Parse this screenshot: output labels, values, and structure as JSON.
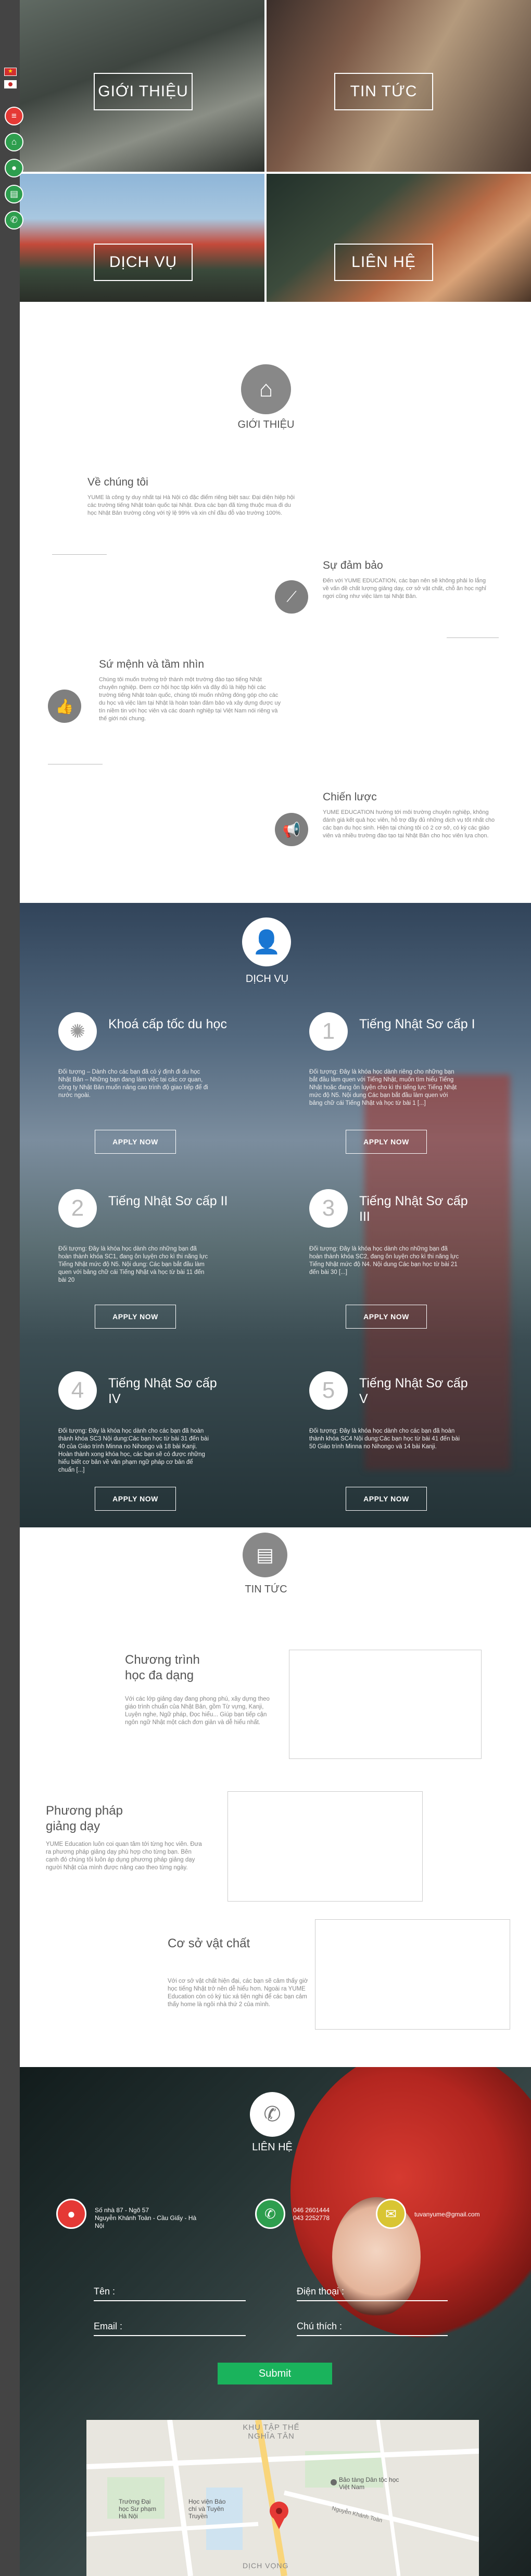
{
  "nav": {
    "tiles": [
      "GIỚI THIỆU",
      "TIN TỨC",
      "DỊCH VỤ",
      "LIÊN HỆ"
    ]
  },
  "about": {
    "title": "GIỚI THIỆU",
    "blocks": [
      {
        "heading": "Về chúng tôi",
        "text": "YUME là công ty duy nhất tại Hà Nội có đặc điểm riêng biệt sau: Đại diện hiệp hội các trường tiếng Nhật toàn quốc tại Nhật. Đưa các bạn đã từng thuộc mua đi du học Nhật Bản trường công với tỷ lệ 99% và xin chỉ đầu đỗ vào trường 100%."
      },
      {
        "heading": "Sự đảm bảo",
        "text": "Đến với YUME EDUCATION, các bạn nên sẽ không phải lo lắng về vấn đề chất lượng giảng dạy, cơ sở vật chất, chỗ ăn học nghỉ ngơi cũng như việc làm tại Nhật Bản."
      },
      {
        "heading": "Sứ mệnh và tầm nhìn",
        "text": "Chúng tôi muốn trường trở thành một trường đào tạo tiếng Nhật chuyên nghiệp. Đem cơ hội học tập kiến và đây đủ là hiệp hội các trường tiếng Nhật toàn quốc, chúng tôi muốn những đóng góp cho các du học và việc làm tại Nhật là hoàn toàn đảm bảo và xây dựng được uy tín niềm tin với học viên và các doanh nghiệp tại Việt Nam nói riêng và thế giới nói chung."
      },
      {
        "heading": "Chiến lược",
        "text": "YUME EDUCATION hướng tới môi trường chuyên nghiệp, không đánh giá kết quả học viên, hỗ trợ đầy đủ những dịch vụ tốt nhất cho các bạn du học sinh. Hiện tại chúng tôi có 2 cơ sở, có kỳ các giáo viên và nhiều trường đào tạo tại Nhật Bản cho học viên lựa chọn."
      }
    ]
  },
  "services": {
    "title": "DỊCH VỤ",
    "apply_label": "APPLY NOW",
    "items": [
      {
        "num": "",
        "name": "Khoá cấp tốc du học",
        "desc": "Đối tượng – Dành cho các bạn đã có ý định đi du học Nhật Bản – Những bạn đang làm việc tại các cơ quan, công ty Nhật Bản muốn nâng cao trình độ giao tiếp để đi nước ngoài."
      },
      {
        "num": "1",
        "name": "Tiếng Nhật Sơ cấp I",
        "desc": "Đối tượng: Đây là khóa học dành riêng cho những bạn bắt đầu làm quen với Tiếng Nhật, muốn tìm hiểu Tiếng Nhật hoặc đang ôn luyện cho kì thi tiếng lực Tiếng Nhật mức độ N5. Nội dung Các bạn bắt đầu làm quen với bảng chữ cái Tiếng Nhật và học từ bài 1 [...]"
      },
      {
        "num": "2",
        "name": "Tiếng Nhật Sơ cấp II",
        "desc": "Đối tượng: Đây là khóa học dành cho những bạn đã hoàn thành khóa SC1, đang ôn luyện cho kì thi năng lực Tiếng Nhật mức độ N5. Nội dung: Các bạn bắt đầu làm quen với bảng chữ cái Tiếng Nhật và học từ bài 11 đến bài 20"
      },
      {
        "num": "3",
        "name": "Tiếng Nhật Sơ cấp III",
        "desc": "Đối tượng: Đây là khóa học dành cho những bạn đã hoàn thành khóa SC2, đang ôn luyện cho kì thi năng lực Tiếng Nhật mức độ N4. Nội dung Các bạn học từ bài 21 đến bài 30 [...]"
      },
      {
        "num": "4",
        "name": "Tiếng Nhật Sơ cấp IV",
        "desc": "Đối tượng: Đây là khóa học dành cho các bạn đã hoàn thành khóa SC3 Nội dung:Các bạn học từ bài 31 đến bài 40 của Giáo trình Minna no Nihongo và 18 bài Kanji. Hoàn thành xong khóa học, các bạn sẽ có được những hiểu biết cơ bản về văn phạm ngữ pháp cơ bản để chuẩn [...]"
      },
      {
        "num": "5",
        "name": "Tiếng Nhật Sơ cấp V",
        "desc": "Đối tượng: Đây là khóa học dành cho các bạn đã hoàn thành khóa SC4 Nội dung:Các bạn học từ bài 41 đến bài 50 Giáo trình Minna no Nihongo và 14 bài Kanji."
      }
    ]
  },
  "news": {
    "title": "TIN TỨC",
    "items": [
      {
        "heading": "Chương trình học đa dạng",
        "text": "Với các lớp giảng dạy đang phong phú, xây dựng theo giáo trình chuẩn của Nhật Bản, gồm Từ vựng, Kanji, Luyện nghe, Ngữ pháp, Đọc hiểu... Giúp bạn tiếp cận ngôn ngữ Nhật một cách đơn giản và dễ hiểu nhất."
      },
      {
        "heading": "Phương pháp giảng dạy",
        "text": "YUME Education luôn coi quan tâm tới từng học viên. Đưa ra phương pháp giảng dạy phù hợp cho từng bạn. Bên cạnh đó chúng tôi luôn áp dụng phương pháp giảng dạy người Nhật của mình được nâng cao theo từng ngày."
      },
      {
        "heading": "Cơ sở vật chất",
        "text": "Với cơ sở vật chất hiện đại, các bạn sẽ cảm thấy giờ học tiếng Nhật trở nên dễ hiểu hơn. Ngoài ra YUME Education còn có ký túc xá tiện nghi để các bạn cảm thấy home là ngôi nhà thứ 2 của mình."
      }
    ]
  },
  "contact": {
    "title": "LIÊN HỆ",
    "address": [
      "Số nhà 87 - Ngõ 57",
      "Nguyễn Khánh Toàn - Cầu Giấy - Hà Nội"
    ],
    "phones": [
      "046 2601444",
      "043 2252778"
    ],
    "email": "tuvanyume@gmail.com",
    "form": {
      "name_label": "Tên :",
      "phone_label": "Điện thoại :",
      "email_label": "Email :",
      "message_label": "Chú thích :",
      "submit_label": "Submit"
    },
    "map_labels": [
      "KHU TẬP THỂ",
      "NGHĨA TÂN",
      "Bảo tàng Dân tộc học Việt Nam",
      "Trường Đại học Sư phạm Hà Nội",
      "Học viện Báo chí và Tuyên Truyền",
      "Nguyễn Khánh Toàn",
      "DỊCH VỌNG"
    ]
  }
}
